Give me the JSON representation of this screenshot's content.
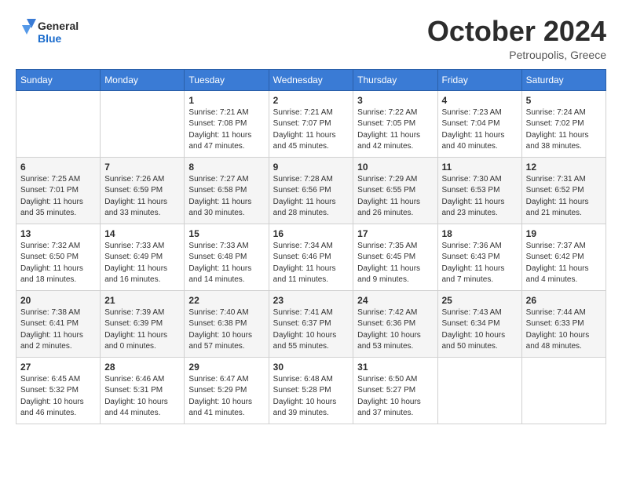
{
  "header": {
    "logo_general": "General",
    "logo_blue": "Blue",
    "month_title": "October 2024",
    "location": "Petroupolis, Greece"
  },
  "weekdays": [
    "Sunday",
    "Monday",
    "Tuesday",
    "Wednesday",
    "Thursday",
    "Friday",
    "Saturday"
  ],
  "weeks": [
    [
      {
        "day": "",
        "info": ""
      },
      {
        "day": "",
        "info": ""
      },
      {
        "day": "1",
        "info": "Sunrise: 7:21 AM\nSunset: 7:08 PM\nDaylight: 11 hours and 47 minutes."
      },
      {
        "day": "2",
        "info": "Sunrise: 7:21 AM\nSunset: 7:07 PM\nDaylight: 11 hours and 45 minutes."
      },
      {
        "day": "3",
        "info": "Sunrise: 7:22 AM\nSunset: 7:05 PM\nDaylight: 11 hours and 42 minutes."
      },
      {
        "day": "4",
        "info": "Sunrise: 7:23 AM\nSunset: 7:04 PM\nDaylight: 11 hours and 40 minutes."
      },
      {
        "day": "5",
        "info": "Sunrise: 7:24 AM\nSunset: 7:02 PM\nDaylight: 11 hours and 38 minutes."
      }
    ],
    [
      {
        "day": "6",
        "info": "Sunrise: 7:25 AM\nSunset: 7:01 PM\nDaylight: 11 hours and 35 minutes."
      },
      {
        "day": "7",
        "info": "Sunrise: 7:26 AM\nSunset: 6:59 PM\nDaylight: 11 hours and 33 minutes."
      },
      {
        "day": "8",
        "info": "Sunrise: 7:27 AM\nSunset: 6:58 PM\nDaylight: 11 hours and 30 minutes."
      },
      {
        "day": "9",
        "info": "Sunrise: 7:28 AM\nSunset: 6:56 PM\nDaylight: 11 hours and 28 minutes."
      },
      {
        "day": "10",
        "info": "Sunrise: 7:29 AM\nSunset: 6:55 PM\nDaylight: 11 hours and 26 minutes."
      },
      {
        "day": "11",
        "info": "Sunrise: 7:30 AM\nSunset: 6:53 PM\nDaylight: 11 hours and 23 minutes."
      },
      {
        "day": "12",
        "info": "Sunrise: 7:31 AM\nSunset: 6:52 PM\nDaylight: 11 hours and 21 minutes."
      }
    ],
    [
      {
        "day": "13",
        "info": "Sunrise: 7:32 AM\nSunset: 6:50 PM\nDaylight: 11 hours and 18 minutes."
      },
      {
        "day": "14",
        "info": "Sunrise: 7:33 AM\nSunset: 6:49 PM\nDaylight: 11 hours and 16 minutes."
      },
      {
        "day": "15",
        "info": "Sunrise: 7:33 AM\nSunset: 6:48 PM\nDaylight: 11 hours and 14 minutes."
      },
      {
        "day": "16",
        "info": "Sunrise: 7:34 AM\nSunset: 6:46 PM\nDaylight: 11 hours and 11 minutes."
      },
      {
        "day": "17",
        "info": "Sunrise: 7:35 AM\nSunset: 6:45 PM\nDaylight: 11 hours and 9 minutes."
      },
      {
        "day": "18",
        "info": "Sunrise: 7:36 AM\nSunset: 6:43 PM\nDaylight: 11 hours and 7 minutes."
      },
      {
        "day": "19",
        "info": "Sunrise: 7:37 AM\nSunset: 6:42 PM\nDaylight: 11 hours and 4 minutes."
      }
    ],
    [
      {
        "day": "20",
        "info": "Sunrise: 7:38 AM\nSunset: 6:41 PM\nDaylight: 11 hours and 2 minutes."
      },
      {
        "day": "21",
        "info": "Sunrise: 7:39 AM\nSunset: 6:39 PM\nDaylight: 11 hours and 0 minutes."
      },
      {
        "day": "22",
        "info": "Sunrise: 7:40 AM\nSunset: 6:38 PM\nDaylight: 10 hours and 57 minutes."
      },
      {
        "day": "23",
        "info": "Sunrise: 7:41 AM\nSunset: 6:37 PM\nDaylight: 10 hours and 55 minutes."
      },
      {
        "day": "24",
        "info": "Sunrise: 7:42 AM\nSunset: 6:36 PM\nDaylight: 10 hours and 53 minutes."
      },
      {
        "day": "25",
        "info": "Sunrise: 7:43 AM\nSunset: 6:34 PM\nDaylight: 10 hours and 50 minutes."
      },
      {
        "day": "26",
        "info": "Sunrise: 7:44 AM\nSunset: 6:33 PM\nDaylight: 10 hours and 48 minutes."
      }
    ],
    [
      {
        "day": "27",
        "info": "Sunrise: 6:45 AM\nSunset: 5:32 PM\nDaylight: 10 hours and 46 minutes."
      },
      {
        "day": "28",
        "info": "Sunrise: 6:46 AM\nSunset: 5:31 PM\nDaylight: 10 hours and 44 minutes."
      },
      {
        "day": "29",
        "info": "Sunrise: 6:47 AM\nSunset: 5:29 PM\nDaylight: 10 hours and 41 minutes."
      },
      {
        "day": "30",
        "info": "Sunrise: 6:48 AM\nSunset: 5:28 PM\nDaylight: 10 hours and 39 minutes."
      },
      {
        "day": "31",
        "info": "Sunrise: 6:50 AM\nSunset: 5:27 PM\nDaylight: 10 hours and 37 minutes."
      },
      {
        "day": "",
        "info": ""
      },
      {
        "day": "",
        "info": ""
      }
    ]
  ]
}
